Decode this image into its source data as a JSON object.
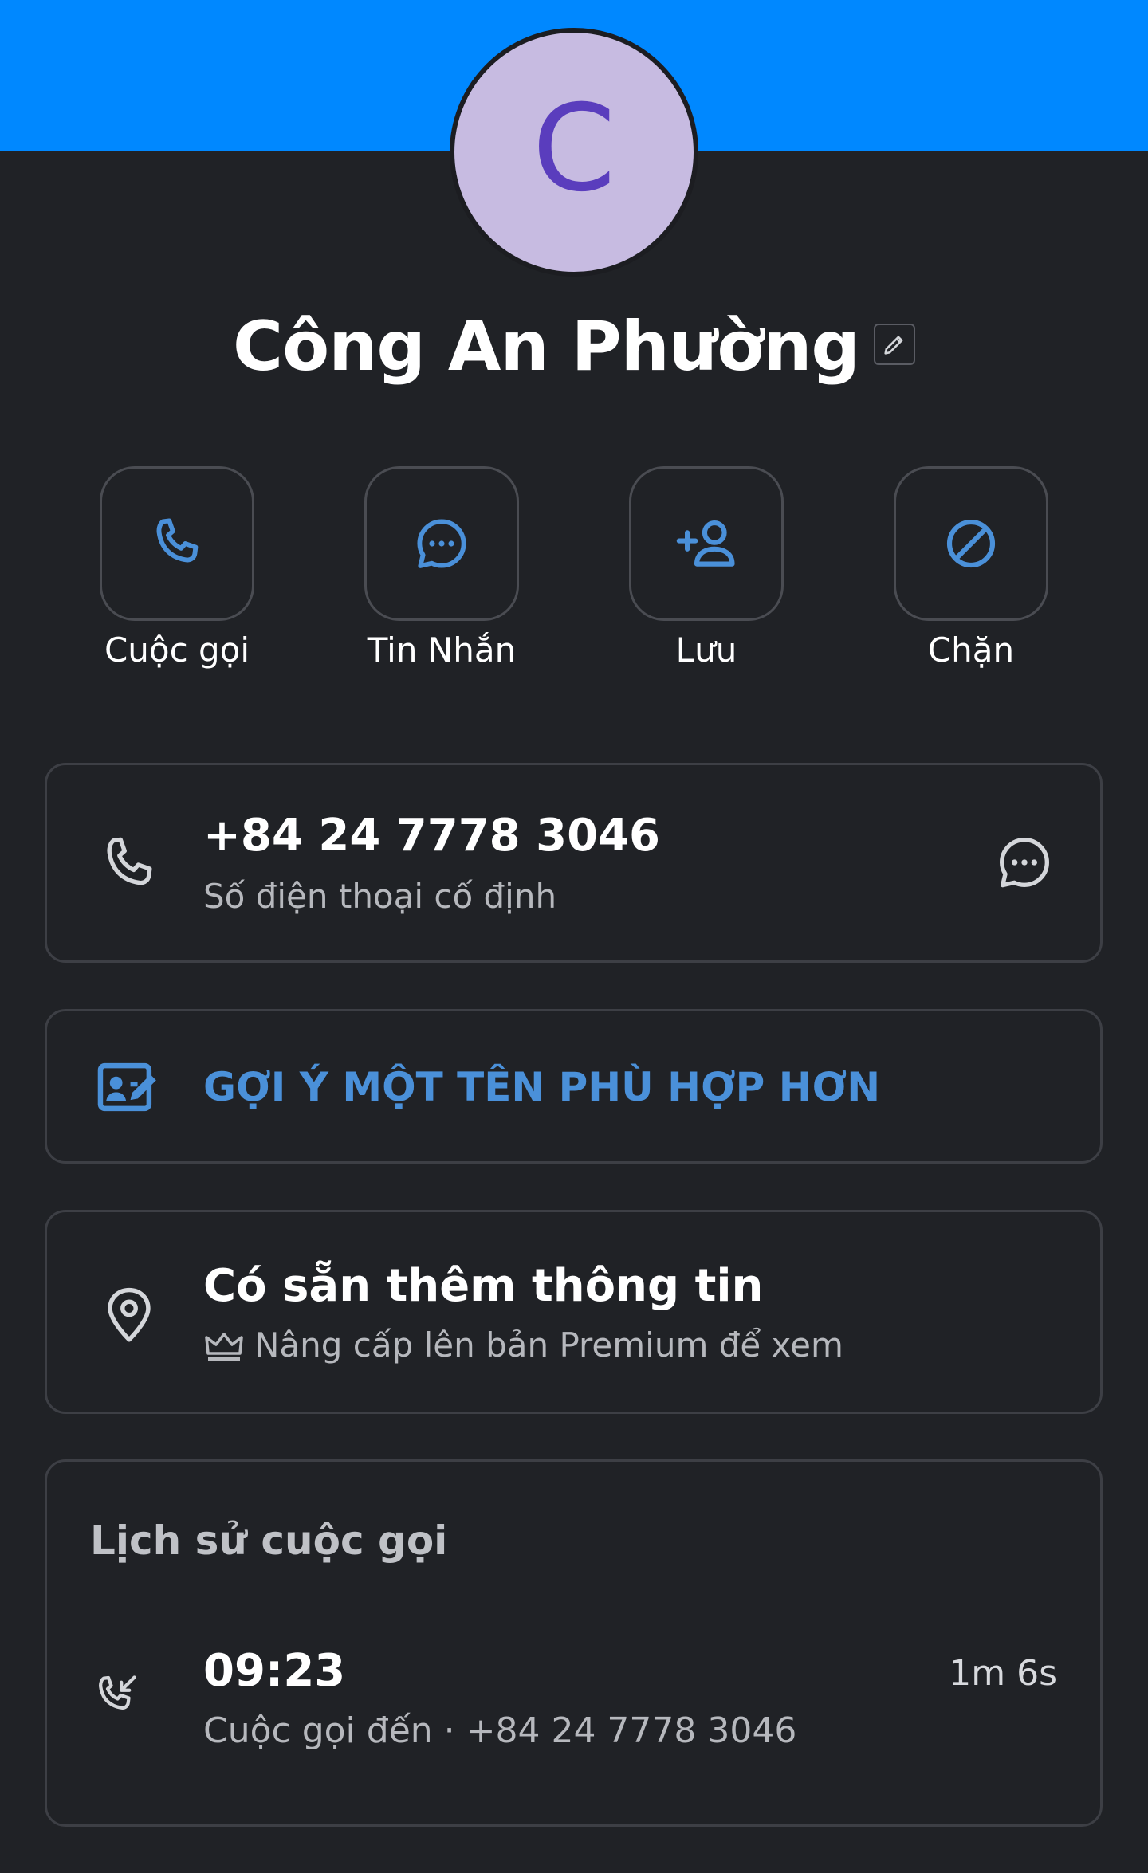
{
  "header": {
    "band_color": "#0088ff"
  },
  "contact": {
    "avatar_letter": "C",
    "avatar_bg": "#c7bbe1",
    "avatar_letter_color": "#5a3dbd",
    "name": "Công An Phường",
    "edit_icon": "pencil-icon"
  },
  "actions": [
    {
      "label": "Cuộc gọi",
      "icon": "phone-icon"
    },
    {
      "label": "Tin Nhắn",
      "icon": "chat-bubble-icon"
    },
    {
      "label": "Lưu",
      "icon": "add-person-icon"
    },
    {
      "label": "Chặn",
      "icon": "block-icon"
    }
  ],
  "phone_card": {
    "number": "+84 24 7778 3046",
    "type": "Số điện thoại cố định",
    "left_icon": "phone-icon",
    "right_icon": "chat-bubble-icon"
  },
  "suggest_card": {
    "label": "GỢI Ý MỘT TÊN PHÙ HỢP HƠN",
    "icon": "edit-contact-card-icon"
  },
  "info_card": {
    "title": "Có sẵn thêm thông tin",
    "subtitle": "Nâng cấp lên bản Premium để xem",
    "left_icon": "location-pin-icon",
    "badge_icon": "crown-icon"
  },
  "history": {
    "title": "Lịch sử cuộc gọi",
    "entries": [
      {
        "time": "09:23",
        "detail": "Cuộc gọi đến · +84 24 7778 3046",
        "duration": "1m 6s",
        "icon": "incoming-call-icon"
      }
    ]
  },
  "colors": {
    "accent_blue": "#4a90d9",
    "background": "#202226",
    "border": "#3d3f45"
  }
}
